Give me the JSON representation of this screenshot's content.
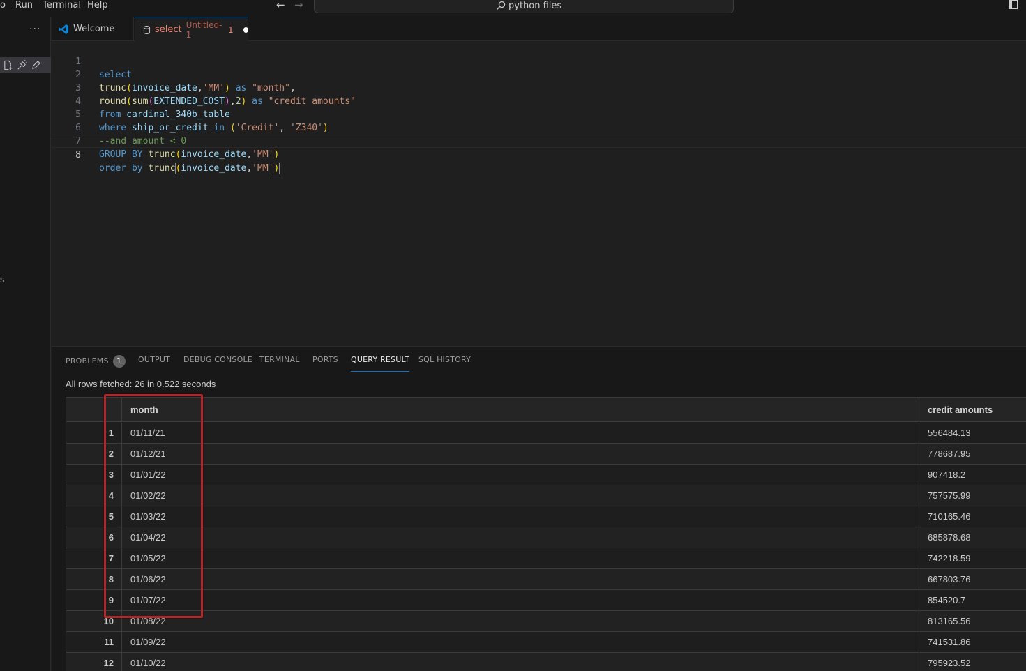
{
  "menu": {
    "items": [
      "o",
      "Run",
      "Terminal",
      "Help"
    ]
  },
  "command_center": {
    "text": "python files",
    "icon": "search-icon"
  },
  "tabs": [
    {
      "label": "Welcome",
      "icon": "vscode-logo-icon"
    },
    {
      "label": "select",
      "description": "Untitled-1",
      "problems": "1",
      "icon": "database-icon"
    }
  ],
  "sidebar": {
    "more": "···",
    "fragment": "s"
  },
  "editor": {
    "lines": [
      {
        "n": "1"
      },
      {
        "n": "2"
      },
      {
        "n": "3"
      },
      {
        "n": "4"
      },
      {
        "n": "5"
      },
      {
        "n": "6"
      },
      {
        "n": "7"
      },
      {
        "n": "8"
      }
    ]
  },
  "panel": {
    "tabs": [
      "PROBLEMS",
      "OUTPUT",
      "DEBUG CONSOLE",
      "TERMINAL",
      "PORTS",
      "QUERY RESULT",
      "SQL HISTORY"
    ],
    "problems_badge": "1",
    "status": "All rows fetched: 26 in 0.522 seconds"
  },
  "grid": {
    "columns": [
      "month",
      "credit amounts"
    ],
    "rows": [
      [
        "1",
        "01/11/21",
        "556484.13"
      ],
      [
        "2",
        "01/12/21",
        "778687.95"
      ],
      [
        "3",
        "01/01/22",
        "907418.2"
      ],
      [
        "4",
        "01/02/22",
        "757575.99"
      ],
      [
        "5",
        "01/03/22",
        "710165.46"
      ],
      [
        "6",
        "01/04/22",
        "685878.68"
      ],
      [
        "7",
        "01/05/22",
        "742218.59"
      ],
      [
        "8",
        "01/06/22",
        "667803.76"
      ],
      [
        "9",
        "01/07/22",
        "854520.7"
      ],
      [
        "10",
        "01/08/22",
        "813165.56"
      ],
      [
        "11",
        "01/09/22",
        "741531.86"
      ],
      [
        "12",
        "01/10/22",
        "795923.52"
      ]
    ]
  }
}
